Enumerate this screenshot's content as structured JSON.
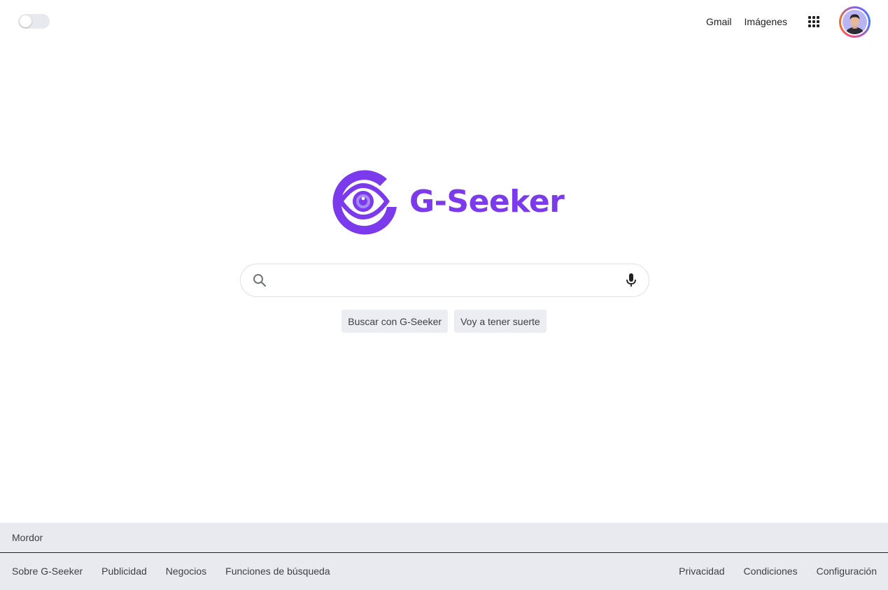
{
  "header": {
    "theme_toggle": {
      "state": "off"
    },
    "links": [
      "Gmail",
      "Imágenes"
    ],
    "apps_icon": "apps-grid-icon",
    "avatar_icon": "user-avatar"
  },
  "logo": {
    "text": "G-Seeker",
    "icon": "eye-g-logo",
    "color": "#7c3aed"
  },
  "search": {
    "value": "",
    "placeholder": "",
    "left_icon": "search-icon",
    "right_icon": "microphone-icon"
  },
  "buttons": {
    "search_label": "Buscar con G-Seeker",
    "lucky_label": "Voy a tener suerte"
  },
  "footer": {
    "location": "Mordor",
    "left_links": [
      "Sobre G-Seeker",
      "Publicidad",
      "Negocios",
      "Funciones de búsqueda"
    ],
    "right_links": [
      "Privacidad",
      "Condiciones",
      "Configuración"
    ]
  },
  "colors": {
    "brand": "#7c3aed",
    "footer_bg": "#e9eaef",
    "button_bg": "#ecedf2"
  }
}
